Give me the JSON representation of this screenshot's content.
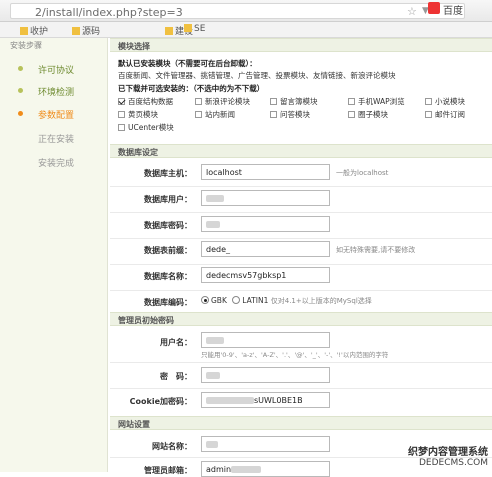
{
  "browser": {
    "url": "2/install/index.php?step=3",
    "search_label": "百度",
    "star_icon": "star-icon",
    "chevron_icon": "chevron-down-icon"
  },
  "bookmarks": [
    "收护",
    "源码",
    "建设",
    "SE"
  ],
  "sidebar": {
    "title": "安装步骤",
    "steps": [
      {
        "label": "许可协议",
        "state": "done"
      },
      {
        "label": "环境检测",
        "state": "done"
      },
      {
        "label": "参数配置",
        "state": "active"
      },
      {
        "label": "正在安装",
        "state": "pending"
      },
      {
        "label": "安装完成",
        "state": "pending"
      }
    ]
  },
  "modules": {
    "section_title": "模块选择",
    "installed_title": "默认已安装模块（不需要可在后台卸载）：",
    "installed_list": "百度新闻、文件管理器、挑错管理、广告管理、投票模块、友情链接、新浪评论模块",
    "optional_title": "已下载并可选安装的：（不选中的为不下载）",
    "options": [
      {
        "label": "百度结构数据",
        "checked": true
      },
      {
        "label": "新浪评论模块",
        "checked": false
      },
      {
        "label": "留言簿模块",
        "checked": false
      },
      {
        "label": "手机WAP浏览",
        "checked": false
      },
      {
        "label": "小说模块",
        "checked": false
      },
      {
        "label": "黄页模块",
        "checked": false
      },
      {
        "label": "站内新闻",
        "checked": false
      },
      {
        "label": "问答模块",
        "checked": false
      },
      {
        "label": "圈子模块",
        "checked": false
      },
      {
        "label": "邮件订阅",
        "checked": false
      },
      {
        "label": "UCenter模块",
        "checked": false
      }
    ]
  },
  "database": {
    "section_title": "数据库设定",
    "host": {
      "label": "数据库主机：",
      "value": "localhost",
      "hint": "一般为localhost"
    },
    "user": {
      "label": "数据库用户：",
      "value": ""
    },
    "password": {
      "label": "数据库密码：",
      "value": ""
    },
    "prefix": {
      "label": "数据表前缀：",
      "value": "dede_",
      "hint": "如无特殊需要,请不要修改"
    },
    "name": {
      "label": "数据库名称：",
      "value": "dedecmsv57gbksp1"
    },
    "charset": {
      "label": "数据库编码：",
      "opt1": "GBK",
      "opt2": "LATIN1",
      "hint": "仅对4.1+以上版本的MySql选择",
      "selected": "GBK"
    }
  },
  "admin": {
    "section_title": "管理员初始密码",
    "username": {
      "label": "用户名：",
      "value": "",
      "hint": "只能用'0-9'、'a-z'、'A-Z'、'.'、'@'、'_'、'-'、'!'以内范围的字符"
    },
    "password": {
      "label": "密　码：",
      "value": ""
    },
    "cookie": {
      "label": "Cookie加密码：",
      "value": "sUWL0BE1B"
    }
  },
  "site": {
    "section_title": "网站设置",
    "name": {
      "label": "网站名称：",
      "value": ""
    },
    "email": {
      "label": "管理员邮箱：",
      "value": "admin"
    }
  },
  "watermark": {
    "line1": "织梦内容管理系统",
    "line2": "DEDECMS.COM"
  }
}
